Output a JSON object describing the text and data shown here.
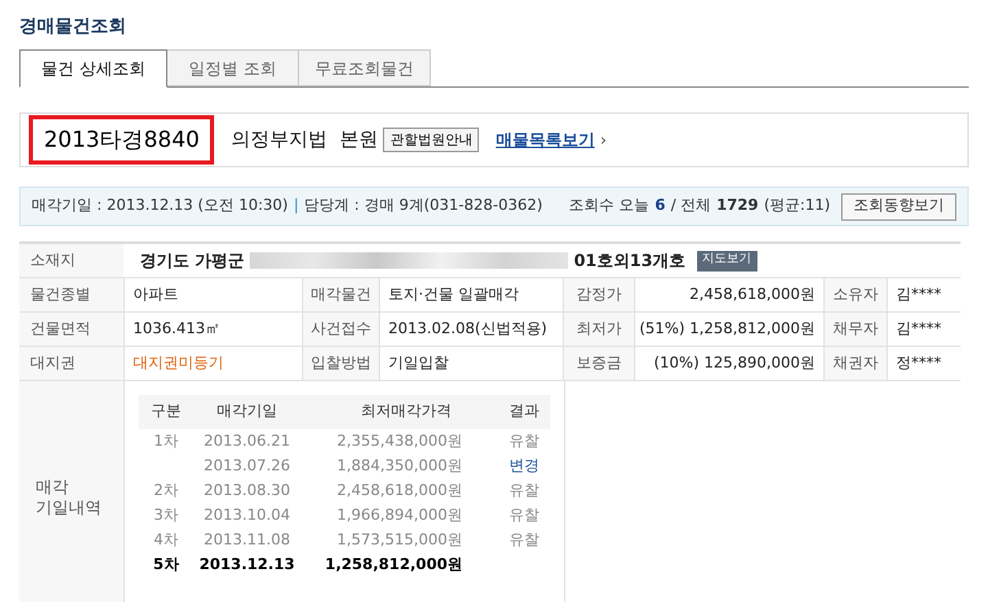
{
  "page_title": "경매물건조회",
  "tabs": [
    {
      "label": "물건 상세조회",
      "selected": true
    },
    {
      "label": "일정별 조회",
      "selected": false
    },
    {
      "label": "무료조회물건",
      "selected": false
    }
  ],
  "case": {
    "number": "2013타경8840",
    "court": "의정부지법  본원",
    "court_button": "관할법원안내",
    "list_link": "매물목록보기",
    "link_arrow": "›"
  },
  "info_bar": {
    "sale_date_label": "매각기일 : 2013.12.13 (오전 10:30)",
    "separator": "|",
    "department": "담당계 : 경매 9계(031-828-0362)",
    "views_label": "조회수 오늘",
    "views_today": "6",
    "views_total_label": "/ 전체",
    "views_total": "1729",
    "views_avg": "(평균:11)",
    "trend_button": "조회동향보기"
  },
  "details": {
    "address_label": "소재지",
    "address_start": "경기도 가평군",
    "address_end": "01호외13개호",
    "map_button": "지도보기",
    "rows": [
      {
        "cells": [
          {
            "label": "물건종별",
            "value": "아파트"
          },
          {
            "label": "매각물건",
            "value": "토지·건물 일괄매각"
          },
          {
            "label": "감정가",
            "value": "2,458,618,000원"
          },
          {
            "label": "소유자",
            "value": "김****"
          }
        ]
      },
      {
        "cells": [
          {
            "label": "건물면적",
            "value": "1036.413㎡"
          },
          {
            "label": "사건접수",
            "value": "2013.02.08(신법적용)"
          },
          {
            "label": "최저가",
            "value": "(51%) 1,258,812,000원"
          },
          {
            "label": "채무자",
            "value": "김****"
          }
        ]
      },
      {
        "cells": [
          {
            "label": "대지권",
            "value": "대지권미등기",
            "highlight": true
          },
          {
            "label": "입찰방법",
            "value": "기일입찰"
          },
          {
            "label": "보증금",
            "value": "(10%) 125,890,000원"
          },
          {
            "label": "채권자",
            "value": "정****"
          }
        ]
      }
    ]
  },
  "history": {
    "label": "매각\n기일내역",
    "columns": [
      "구분",
      "매각기일",
      "최저매각가격",
      "결과"
    ],
    "rows": [
      {
        "round": "1차",
        "date": "2013.06.21",
        "price": "2,355,438,000원",
        "result": "유찰",
        "changed": false,
        "current": false
      },
      {
        "date": "2013.07.26",
        "price": "1,884,350,000원",
        "result": "변경",
        "changed": true,
        "current": false
      },
      {
        "round": "2차",
        "date": "2013.08.30",
        "price": "2,458,618,000원",
        "result": "유찰",
        "changed": false,
        "current": false
      },
      {
        "round": "3차",
        "date": "2013.10.04",
        "price": "1,966,894,000원",
        "result": "유찰",
        "changed": false,
        "current": false
      },
      {
        "round": "4차",
        "date": "2013.11.08",
        "price": "1,573,515,000원",
        "result": "유찰",
        "changed": false,
        "current": false
      },
      {
        "round": "5차",
        "date": "2013.12.13",
        "price": "1,258,812,000원",
        "current": true
      }
    ]
  }
}
